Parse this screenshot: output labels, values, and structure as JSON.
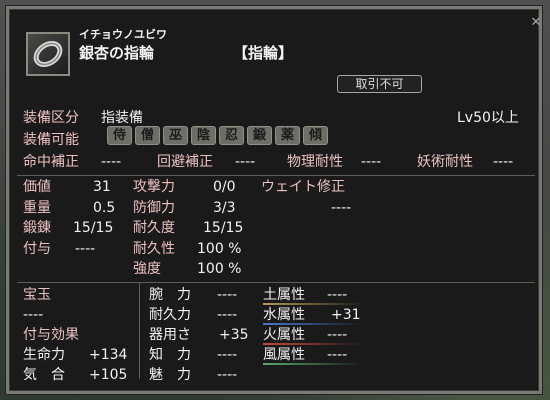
{
  "item": {
    "icon": "silver-ring-icon",
    "furigana": "イチョウノユビワ",
    "name": "銀杏の指輪",
    "category": "【指輪】",
    "no_trade": "取引不可"
  },
  "equip": {
    "slot_label": "装備区分",
    "slot_value": "指装備",
    "level_req": "Lv50以上",
    "usable_label": "装備可能",
    "classes": [
      "侍",
      "僧",
      "巫",
      "陰",
      "忍",
      "鍛",
      "薬",
      "傾"
    ]
  },
  "stats_row": [
    {
      "label": "命中補正",
      "value": "----"
    },
    {
      "label": "回避補正",
      "value": "----"
    },
    {
      "label": "物理耐性",
      "value": "----"
    },
    {
      "label": "妖術耐性",
      "value": "----"
    }
  ],
  "basic": {
    "price_label": "価値",
    "price": "31",
    "weight_label": "重量",
    "weight": "0.5",
    "forge_label": "鍛錬",
    "forge": "15/15",
    "enchant_label": "付与",
    "enchant": "----",
    "attack_label": "攻撃力",
    "attack": "0/0",
    "defense_label": "防御力",
    "defense": "3/3",
    "durability_label": "耐久度",
    "durability": "15/15",
    "dur_prop_label": "耐久性",
    "dur_prop": "100 %",
    "strength_label": "強度",
    "strength": "100 %",
    "weight_mod_label": "ウェイト修正",
    "weight_mod": "----"
  },
  "gem": {
    "label": "宝玉",
    "value": "----"
  },
  "effects": {
    "label": "付与効果",
    "life_label": "生命力",
    "life": "+134",
    "ki_label": "気　合",
    "ki": "+105"
  },
  "attributes": [
    {
      "label": "腕　力",
      "value": "----"
    },
    {
      "label": "耐久力",
      "value": "----"
    },
    {
      "label": "器用さ",
      "value": "+35"
    },
    {
      "label": "知　力",
      "value": "----"
    },
    {
      "label": "魅　力",
      "value": "----"
    }
  ],
  "elements": [
    {
      "label": "土属性",
      "value": "----",
      "color": "#b89a50"
    },
    {
      "label": "水属性",
      "value": "+31",
      "color": "#4878c8"
    },
    {
      "label": "火属性",
      "value": "----",
      "color": "#c84a3a"
    },
    {
      "label": "風属性",
      "value": "----",
      "color": "#5aa870"
    }
  ]
}
